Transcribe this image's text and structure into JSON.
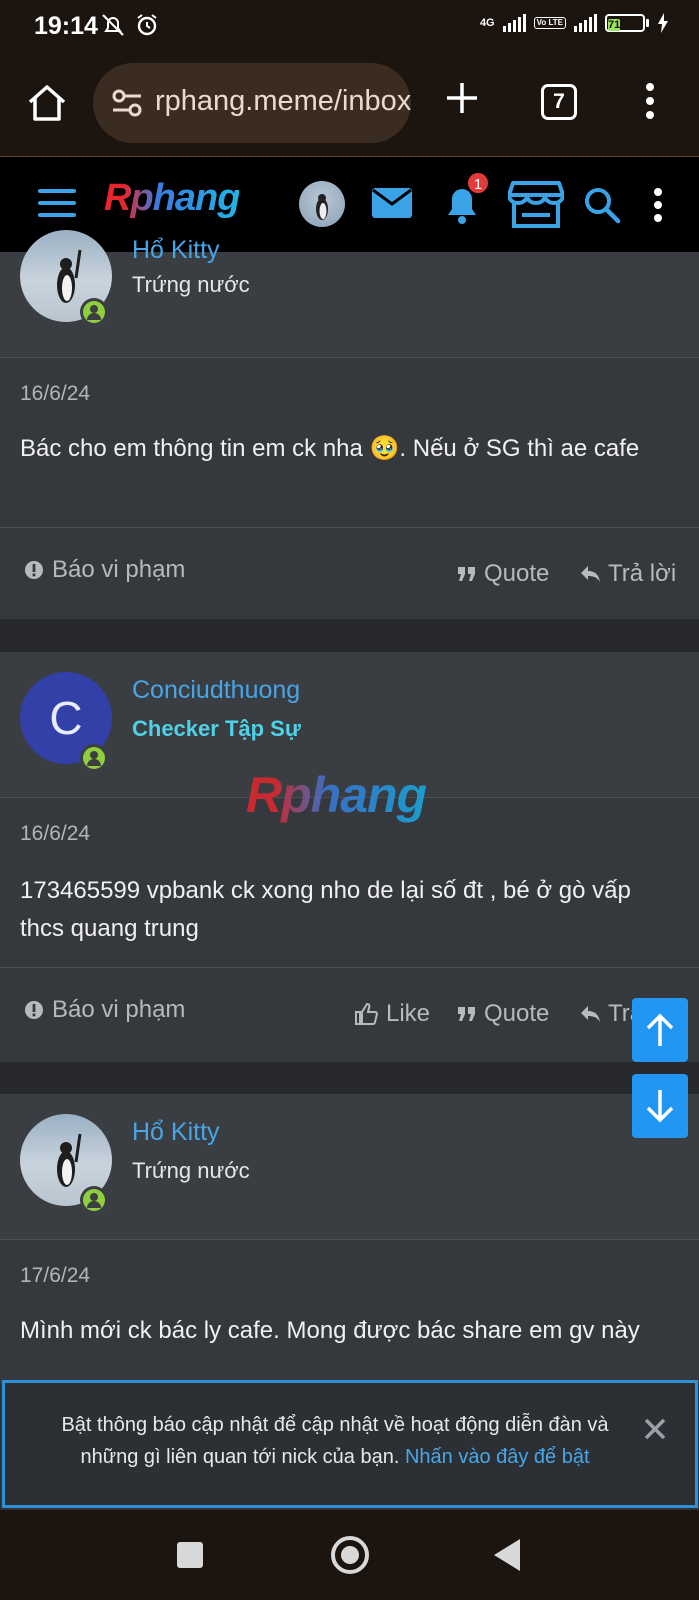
{
  "status_bar": {
    "time": "19:14",
    "network": "4G",
    "volte": "Vo LTE",
    "battery": "71"
  },
  "browser": {
    "url": "rphang.meme/inbox",
    "tab_count": "7"
  },
  "forum": {
    "logo": "Rphang",
    "watermark": "Rphang",
    "notification_count": "1"
  },
  "posts": [
    {
      "username": "Hổ Kitty",
      "user_title": "Trứng nước",
      "date": "16/6/24",
      "body": "Bác cho em thông tin em ck nha 🥹. Nếu ở SG thì ae cafe",
      "report": "Báo vi phạm",
      "quote": "Quote",
      "reply": "Trả lời"
    },
    {
      "username": "Conciudthuong",
      "avatar_letter": "C",
      "user_title": "Checker Tập Sự",
      "date": "16/6/24",
      "body": "173465599 vpbank ck xong nho de lại số đt , bé ở gò vấp thcs quang trung",
      "report": "Báo vi phạm",
      "like": "Like",
      "quote": "Quote",
      "reply": "Trả lời"
    },
    {
      "username": "Hổ Kitty",
      "user_title": "Trứng nước",
      "date": "17/6/24",
      "body": "Mình mới ck bác ly cafe. Mong được bác share em gv này"
    }
  ],
  "notice": {
    "text": "Bật thông báo cập nhật để cập nhật về hoạt động diễn đàn và những gì liên quan tới nick của bạn.",
    "link": "Nhấn vào đây để bật"
  },
  "colors": {
    "accent": "#48a6e8",
    "online": "#8fcf3c",
    "scroll_button": "#2196f3",
    "badge": "#e23b3b"
  }
}
